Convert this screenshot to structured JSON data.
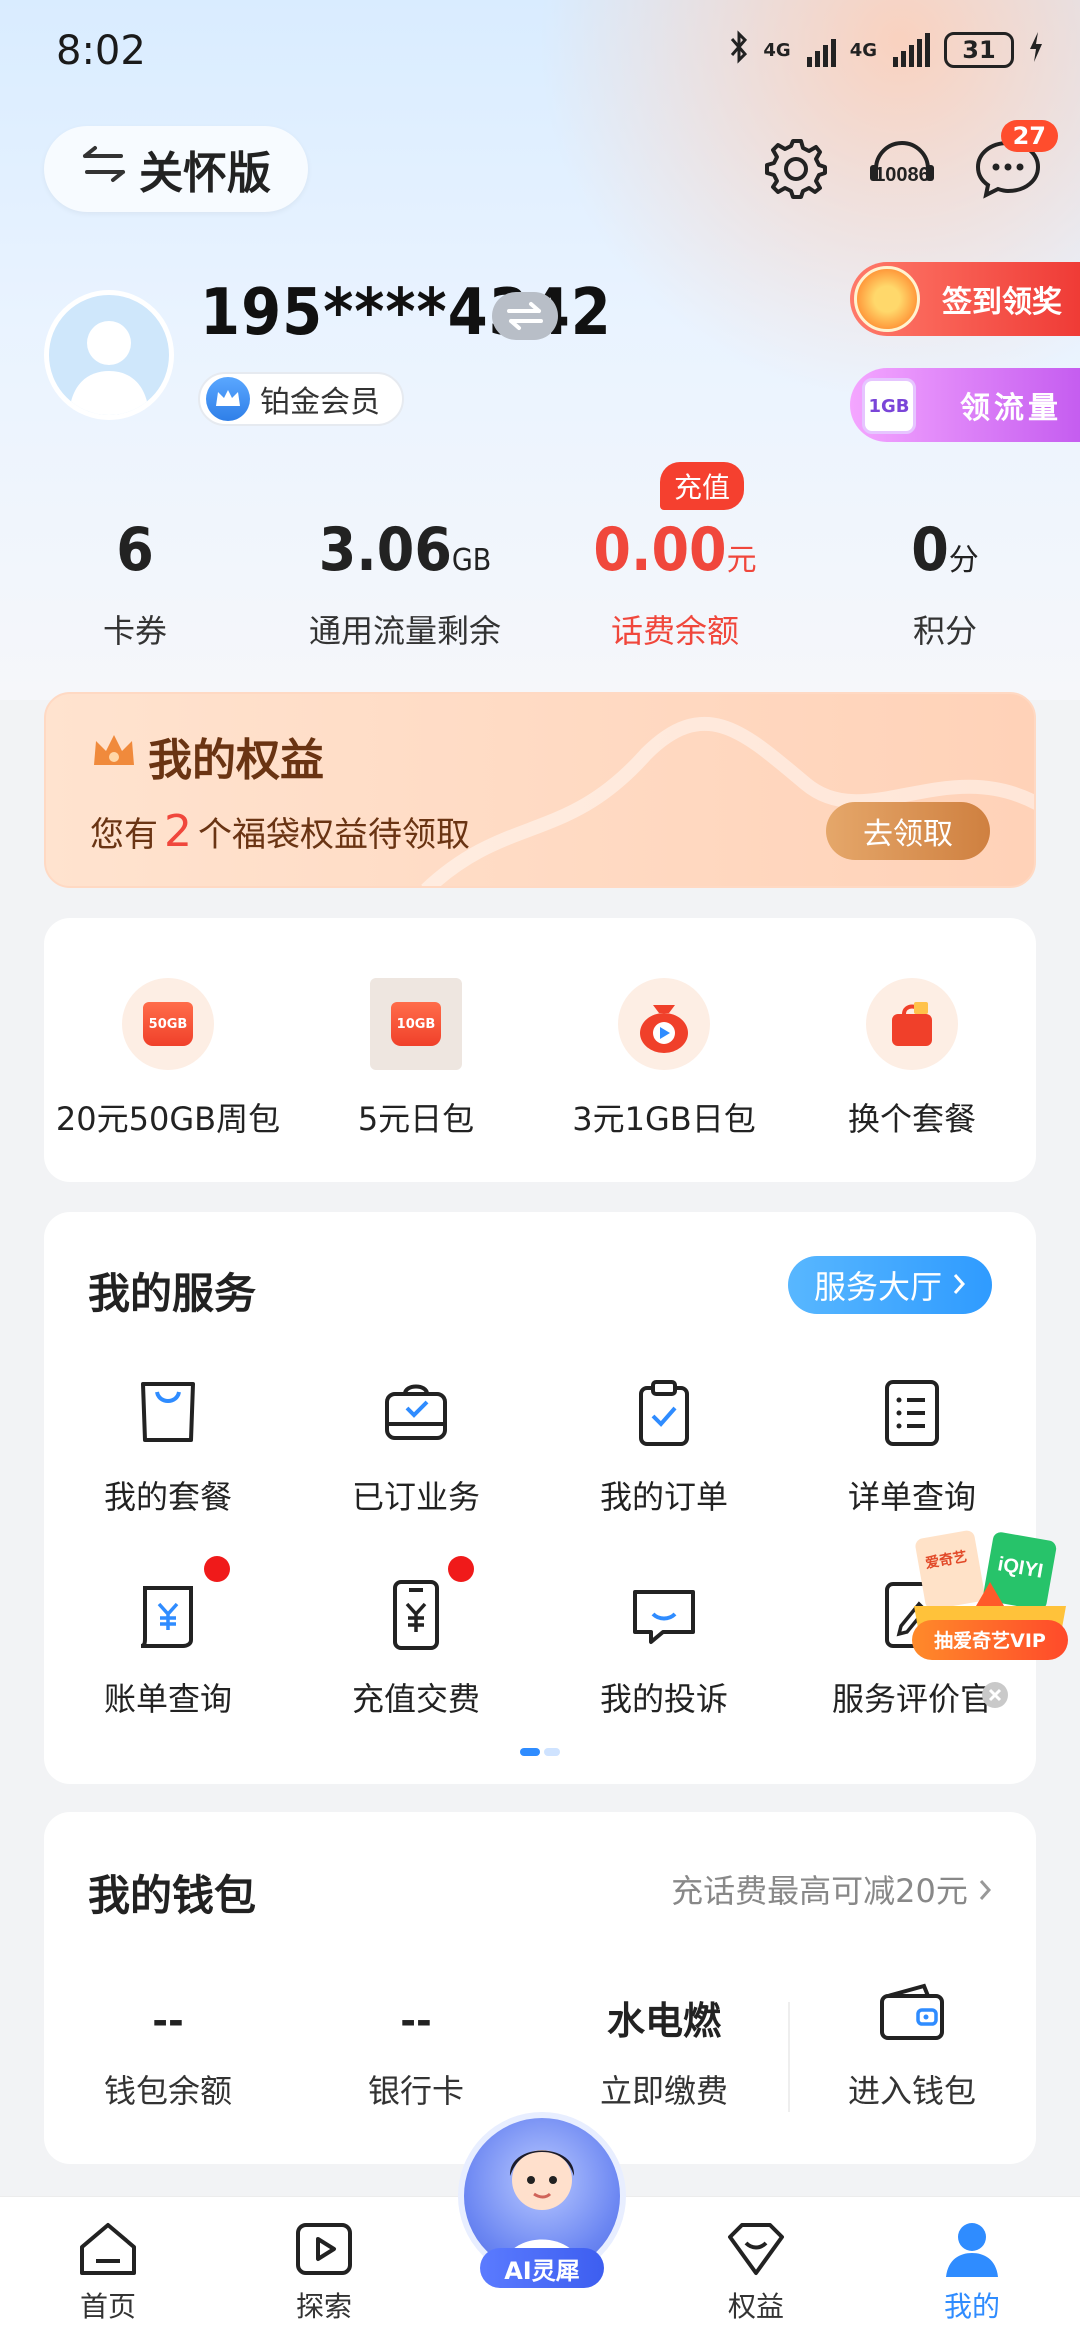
{
  "status_bar": {
    "time": "8:02",
    "net1": "4G",
    "net2": "4G",
    "battery": "31"
  },
  "header": {
    "care_mode_label": "关怀版",
    "service_hotline": "10086",
    "message_badge": "27"
  },
  "profile": {
    "phone": "195****4342",
    "member_level": "铂金会员"
  },
  "promo_pills": {
    "sign_in": "签到领奖",
    "flow_gb": "1GB",
    "get_flow": "领流量"
  },
  "stats": [
    {
      "value": "6",
      "unit": "",
      "label": "卡券"
    },
    {
      "value": "3.06",
      "unit": "GB",
      "label": "通用流量剩余"
    },
    {
      "value": "0.00",
      "unit": "元",
      "label": "话费余额",
      "tag": "充值"
    },
    {
      "value": "0",
      "unit": "分",
      "label": "积分"
    }
  ],
  "rights": {
    "title": "我的权益",
    "prefix": "您有",
    "count": "2",
    "suffix": "个福袋权益待领取",
    "button": "去领取"
  },
  "packages": [
    {
      "label": "20元50GB周包",
      "icon_text": "50GB"
    },
    {
      "label": "5元日包",
      "icon_text": "10GB"
    },
    {
      "label": "3元1GB日包",
      "icon_text": ""
    },
    {
      "label": "换个套餐",
      "icon_text": ""
    }
  ],
  "services": {
    "title": "我的服务",
    "hall_button": "服务大厅",
    "items": [
      {
        "label": "我的套餐"
      },
      {
        "label": "已订业务"
      },
      {
        "label": "我的订单"
      },
      {
        "label": "详单查询"
      },
      {
        "label": "账单查询"
      },
      {
        "label": "充值交费"
      },
      {
        "label": "我的投诉"
      },
      {
        "label": "服务评价官"
      }
    ]
  },
  "vip_float": {
    "label": "抽爱奇艺VIP",
    "brand": "爱奇艺",
    "brand_en": "iQIYI"
  },
  "wallet": {
    "title": "我的钱包",
    "promo": "充话费最高可减20元",
    "items": [
      {
        "value": "--",
        "label": "钱包余额"
      },
      {
        "value": "--",
        "label": "银行卡"
      },
      {
        "value": "水电燃",
        "label": "立即缴费"
      },
      {
        "value": "",
        "label": "进入钱包"
      }
    ]
  },
  "tabbar": {
    "items": [
      {
        "label": "首页"
      },
      {
        "label": "探索"
      },
      {
        "label": "权益"
      },
      {
        "label": "我的"
      }
    ],
    "ai_label": "AI灵犀"
  },
  "colors": {
    "accent": "#2f8cff",
    "red": "#f0473c",
    "rights_text": "#6a3413"
  }
}
